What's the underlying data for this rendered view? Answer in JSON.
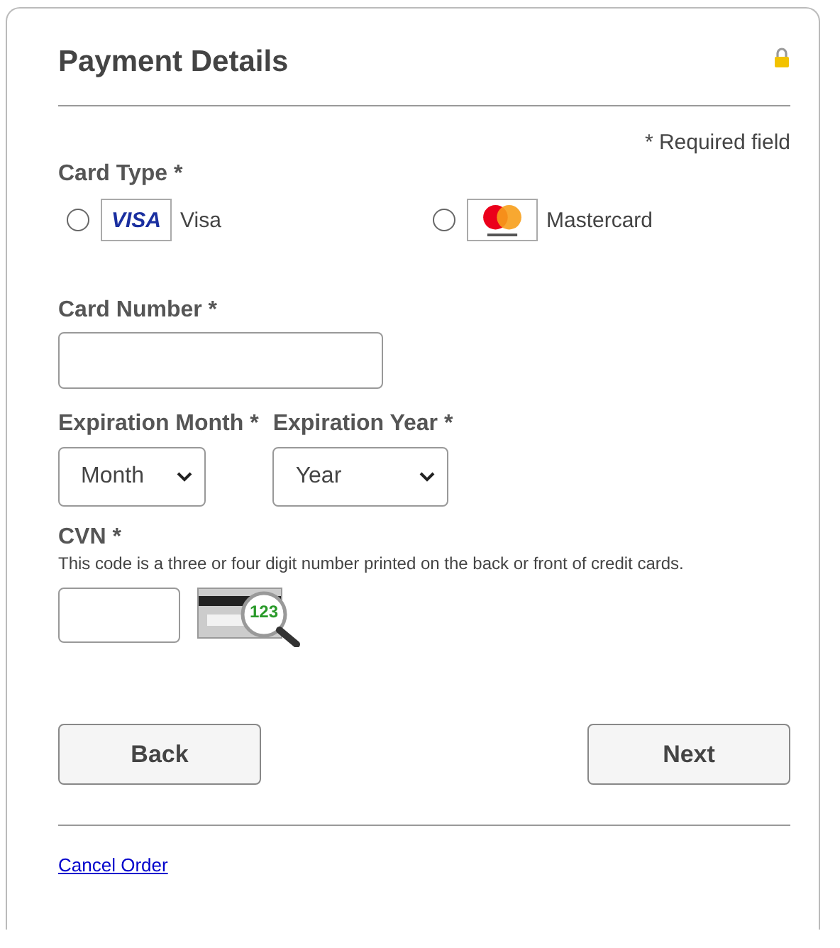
{
  "title": "Payment Details",
  "required_note": "* Required field",
  "card_type": {
    "label": "Card Type *",
    "options": [
      {
        "kind": "visa",
        "logo_text": "VISA",
        "label": "Visa",
        "selected": false
      },
      {
        "kind": "mastercard",
        "label": "Mastercard",
        "selected": false
      }
    ]
  },
  "card_number": {
    "label": "Card Number *"
  },
  "expiration": [
    {
      "label": "Expiration Month *",
      "value": "Month"
    },
    {
      "label": "Expiration Year *",
      "value": "Year"
    }
  ],
  "cvn": {
    "label": "CVN *",
    "help": "This code is a three or four digit number printed on the back or front of credit cards.",
    "illustration_digits": "123"
  },
  "buttons": [
    "Back",
    "Next"
  ],
  "cancel_link": "Cancel Order"
}
